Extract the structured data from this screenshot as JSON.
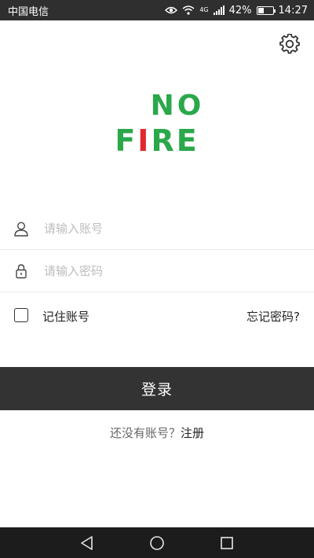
{
  "status_bar": {
    "carrier": "中国电信",
    "network": "4G",
    "battery": "42%",
    "battery_level": 0.42,
    "time": "14:27"
  },
  "logo": {
    "line1": "NO",
    "line2_prefix": "F",
    "line2_i": "I",
    "line2_suffix": "RE",
    "green": "#2aa84a",
    "red": "#e0282e"
  },
  "form": {
    "account_placeholder": "请输入账号",
    "password_placeholder": "请输入密码",
    "remember_label": "记住账号",
    "forgot_link": "忘记密码?"
  },
  "login_button": "登录",
  "register": {
    "question": "还没有账号？",
    "link": "注册"
  },
  "icons": {
    "settings": "gear-icon",
    "account": "user-icon",
    "password": "lock-icon",
    "nav_back": "triangle-back-icon",
    "nav_home": "circle-home-icon",
    "nav_recents": "square-recents-icon"
  }
}
